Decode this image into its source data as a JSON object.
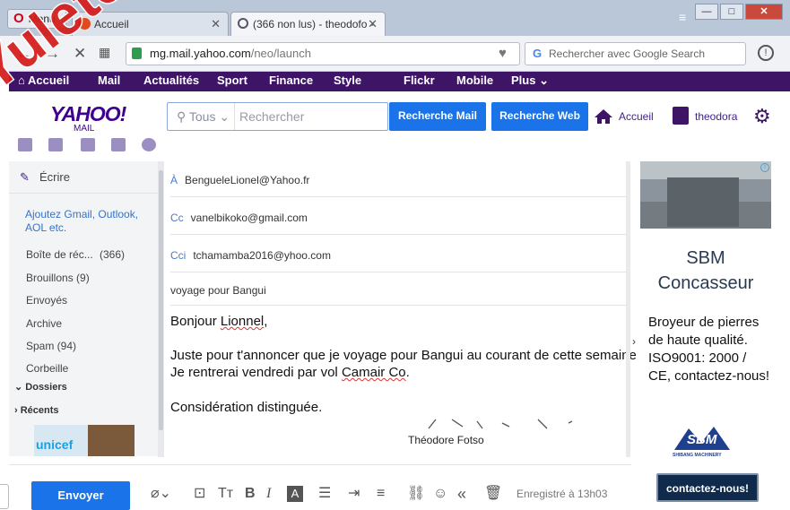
{
  "browser": {
    "menu_label": "Menu",
    "tabs": [
      {
        "label": "Accueil",
        "icon": "yahoo-favicon"
      },
      {
        "label": "(366 non lus) - theodofo -",
        "icon": "loading-spinner"
      }
    ],
    "url_domain": "mg.mail.yahoo.com",
    "url_path": "/neo/launch",
    "search_placeholder": "Rechercher avec Google Search"
  },
  "yahoo_nav": {
    "items": [
      "Accueil",
      "Mail",
      "Actualités",
      "Sport",
      "Finance",
      "Style",
      "Flickr",
      "Mobile",
      "Plus"
    ]
  },
  "header": {
    "logo": "YAHOO!",
    "logo_sub": "MAIL",
    "search_scope": "Tous",
    "search_placeholder": "Rechercher",
    "btn_mail": "Recherche Mail",
    "btn_web": "Recherche Web",
    "home_label": "Accueil",
    "user_name": "theodora"
  },
  "sidebar": {
    "compose_label": "Écrire",
    "add_accounts": "Ajoutez Gmail, Outlook, AOL etc.",
    "folders": [
      {
        "name": "Boîte de réc...",
        "count": "(366)"
      },
      {
        "name": "Brouillons (9)"
      },
      {
        "name": "Envoyés"
      },
      {
        "name": "Archive"
      },
      {
        "name": "Spam (94)"
      },
      {
        "name": "Corbeille"
      }
    ],
    "section_dossiers": "Dossiers",
    "section_recents": "Récents",
    "promo_text": "unicef"
  },
  "compose": {
    "to_label": "À",
    "to_value": "BengueleLionel@Yahoo.fr",
    "cc_label": "Cc",
    "cc_value": "vanelbikoko@gmail.com",
    "bcc_label": "Cci",
    "bcc_value": "tchamamba2016@yhoo.com",
    "subject": "voyage pour Bangui",
    "greeting_prefix": "Bonjour ",
    "greeting_name": "Lionnel",
    "greeting_suffix": ",",
    "line1": "Juste pour t'annoncer que je voyage pour Bangui au courant de cette semaine",
    "line2_prefix": "Je rentrerai vendredi par vol ",
    "line2_airline": "Camair Co",
    "line2_suffix": ".",
    "closing": "Considération distinguée.",
    "signature": "Théodore Fotso"
  },
  "toolbar": {
    "send_label": "Envoyer",
    "saved_status": "Enregistré à 13h03"
  },
  "ad": {
    "title_line1": "SBM",
    "title_line2": "Concasseur",
    "body": "Broyeur de pierres de haute qualité. ISO9001: 2000 / CE, contactez-nous!",
    "logo_text": "SBM",
    "logo_sub": "SHIBANG MACHINERY",
    "cta": "contactez-nous!"
  },
  "watermark": "Yuletex",
  "colors": {
    "yahoo_purple": "#3d1466",
    "button_blue": "#1a73e8",
    "watermark_red": "#d41a1a"
  }
}
